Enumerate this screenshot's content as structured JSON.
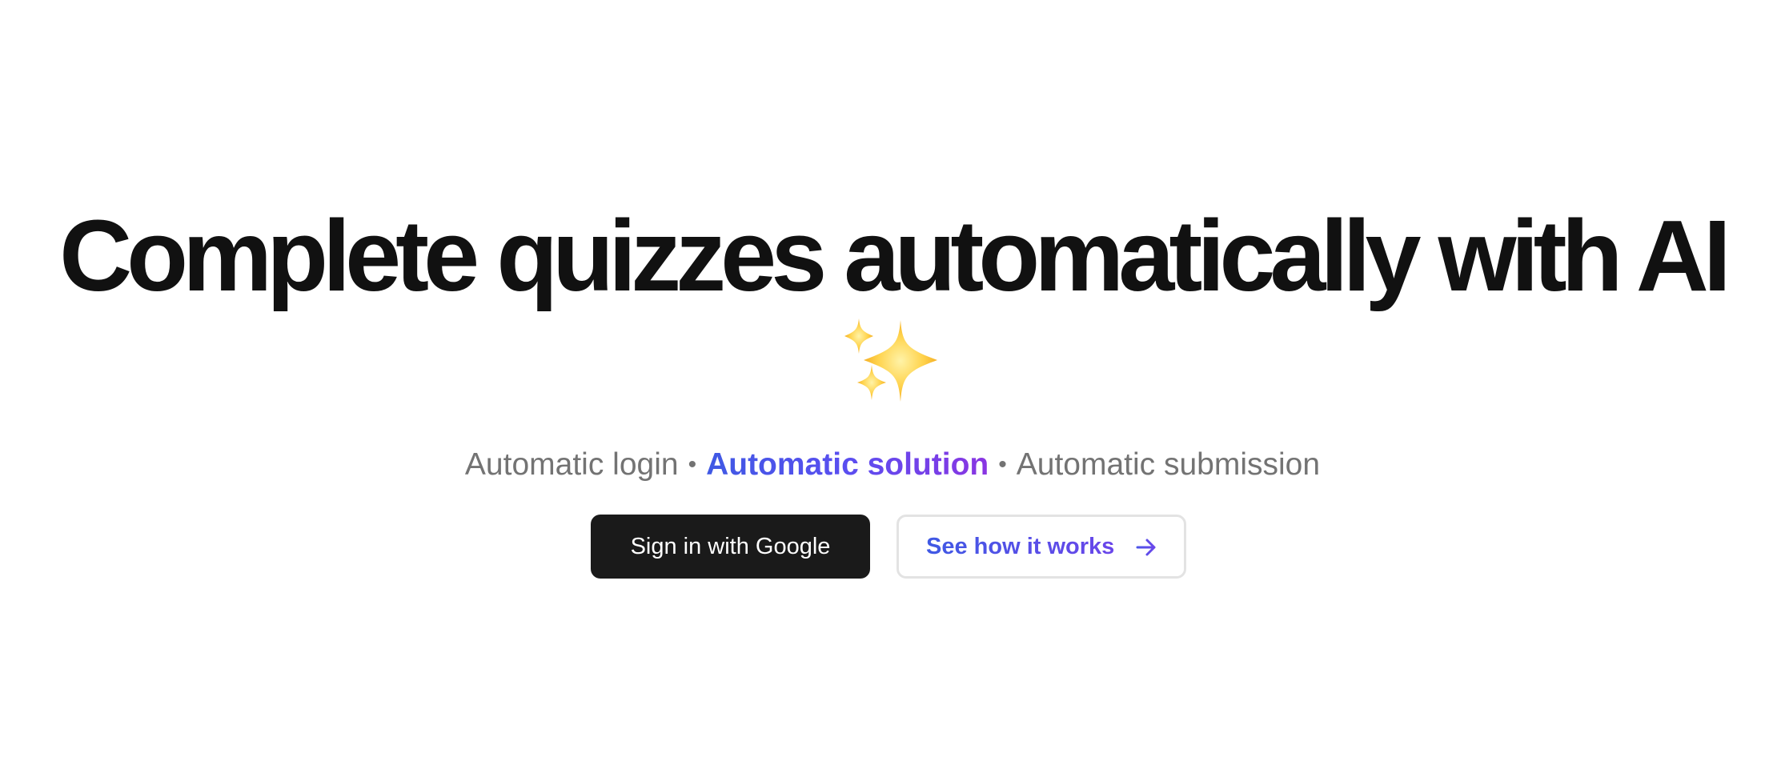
{
  "hero": {
    "headline": "Complete quizzes automatically with AI",
    "sparkles_emoji": "sparkles-icon",
    "features": {
      "item1": "Automatic login",
      "separator": "•",
      "item2": "Automatic solution",
      "item3": "Automatic submission"
    },
    "buttons": {
      "primary_label": "Sign in with Google",
      "secondary_label": "See how it works",
      "secondary_icon": "arrow-right-icon"
    }
  },
  "colors": {
    "headline": "#111111",
    "subtitle": "#737373",
    "accent_start": "#3f59e4",
    "accent_end": "#8a35e2",
    "primary_button_bg": "#1a1a1a",
    "secondary_button_border": "#e3e3e3"
  }
}
